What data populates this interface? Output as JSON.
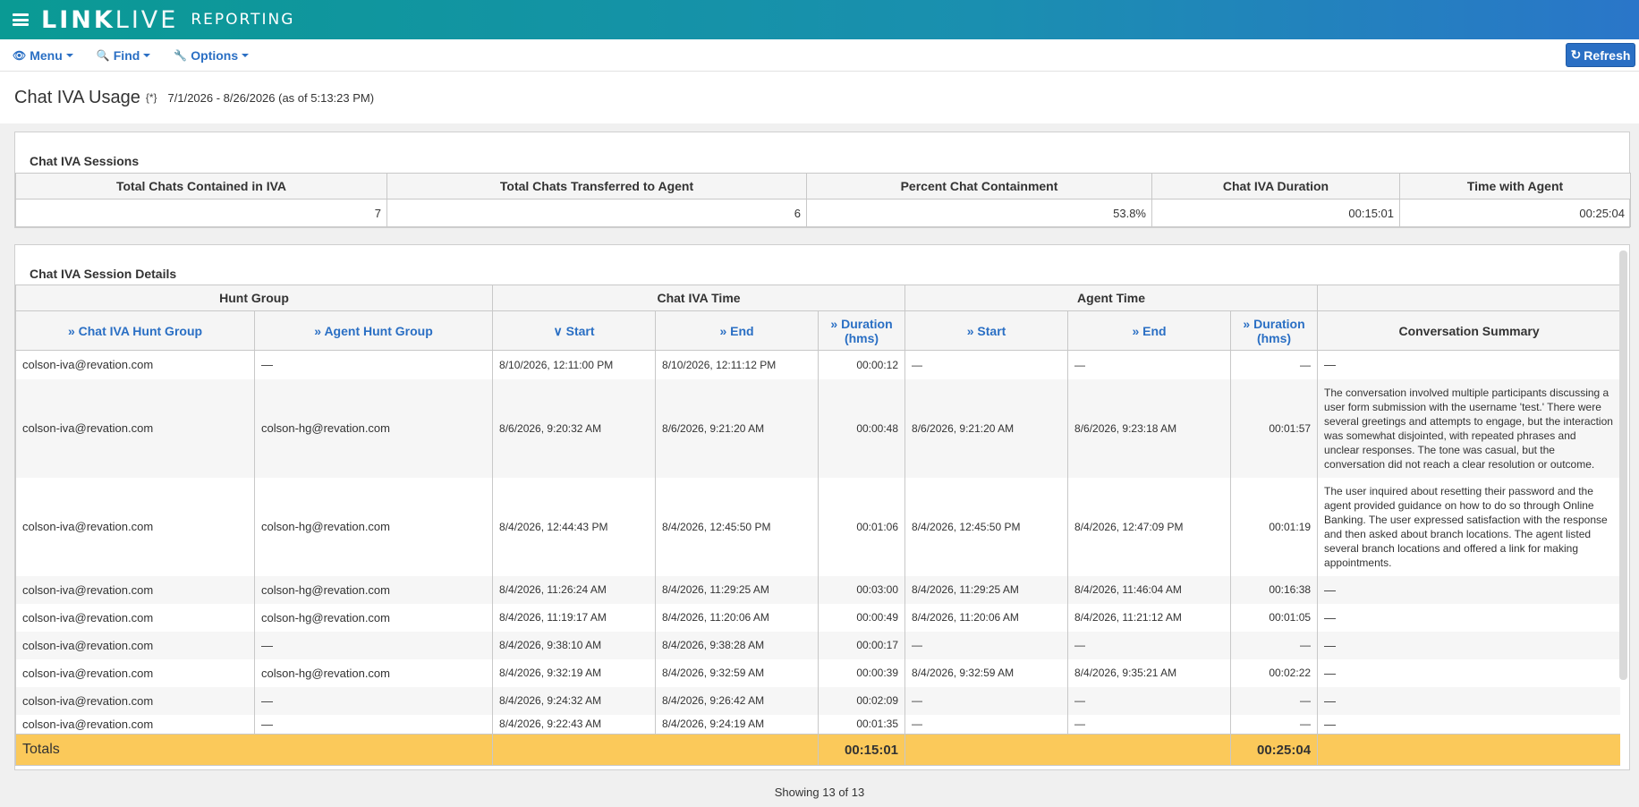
{
  "brand": {
    "bold": "LINK",
    "light": "LIVE",
    "sub": "REPORTING"
  },
  "toolbar": {
    "menu": "Menu",
    "find": "Find",
    "options": "Options",
    "refresh": "Refresh"
  },
  "page": {
    "title": "Chat IVA Usage",
    "flag": "{*}",
    "date_range": "7/1/2026 - 8/26/2026 (as of 5:13:23 PM)"
  },
  "sessions": {
    "title": "Chat IVA Sessions",
    "headers": [
      "Total Chats Contained in IVA",
      "Total Chats Transferred to Agent",
      "Percent Chat Containment",
      "Chat IVA Duration",
      "Time with Agent"
    ],
    "values": [
      "7",
      "6",
      "53.8%",
      "00:15:01",
      "00:25:04"
    ]
  },
  "details": {
    "title": "Chat IVA Session Details",
    "groups": [
      "Hunt Group",
      "Chat IVA Time",
      "Agent Time",
      ""
    ],
    "columns": [
      "Chat IVA Hunt Group",
      "Agent Hunt Group",
      "Start",
      "End",
      "Duration (hms)",
      "Start",
      "End",
      "Duration (hms)",
      "Conversation Summary"
    ],
    "rows": [
      {
        "iva_hg": "colson-iva@revation.com",
        "agent_hg": "—",
        "iva_start": "8/10/2026, 12:11:00 PM",
        "iva_end": "8/10/2026, 12:11:12 PM",
        "iva_dur": "00:00:12",
        "ag_start": "—",
        "ag_end": "—",
        "ag_dur": "—",
        "summary": "—"
      },
      {
        "iva_hg": "colson-iva@revation.com",
        "agent_hg": "colson-hg@revation.com",
        "iva_start": "8/6/2026, 9:20:32 AM",
        "iva_end": "8/6/2026, 9:21:20 AM",
        "iva_dur": "00:00:48",
        "ag_start": "8/6/2026, 9:21:20 AM",
        "ag_end": "8/6/2026, 9:23:18 AM",
        "ag_dur": "00:01:57",
        "summary": "The conversation involved multiple participants discussing a user form submission with the username 'test.' There were several greetings and attempts to engage, but the interaction was somewhat disjointed, with repeated phrases and unclear responses. The tone was casual, but the conversation did not reach a clear resolution or outcome."
      },
      {
        "iva_hg": "colson-iva@revation.com",
        "agent_hg": "colson-hg@revation.com",
        "iva_start": "8/4/2026, 12:44:43 PM",
        "iva_end": "8/4/2026, 12:45:50 PM",
        "iva_dur": "00:01:06",
        "ag_start": "8/4/2026, 12:45:50 PM",
        "ag_end": "8/4/2026, 12:47:09 PM",
        "ag_dur": "00:01:19",
        "summary": "The user inquired about resetting their password and the agent provided guidance on how to do so through Online Banking. The user expressed satisfaction with the response and then asked about branch locations. The agent listed several branch locations and offered a link for making appointments."
      },
      {
        "iva_hg": "colson-iva@revation.com",
        "agent_hg": "colson-hg@revation.com",
        "iva_start": "8/4/2026, 11:26:24 AM",
        "iva_end": "8/4/2026, 11:29:25 AM",
        "iva_dur": "00:03:00",
        "ag_start": "8/4/2026, 11:29:25 AM",
        "ag_end": "8/4/2026, 11:46:04 AM",
        "ag_dur": "00:16:38",
        "summary": "—"
      },
      {
        "iva_hg": "colson-iva@revation.com",
        "agent_hg": "colson-hg@revation.com",
        "iva_start": "8/4/2026, 11:19:17 AM",
        "iva_end": "8/4/2026, 11:20:06 AM",
        "iva_dur": "00:00:49",
        "ag_start": "8/4/2026, 11:20:06 AM",
        "ag_end": "8/4/2026, 11:21:12 AM",
        "ag_dur": "00:01:05",
        "summary": "—"
      },
      {
        "iva_hg": "colson-iva@revation.com",
        "agent_hg": "—",
        "iva_start": "8/4/2026, 9:38:10 AM",
        "iva_end": "8/4/2026, 9:38:28 AM",
        "iva_dur": "00:00:17",
        "ag_start": "—",
        "ag_end": "—",
        "ag_dur": "—",
        "summary": "—"
      },
      {
        "iva_hg": "colson-iva@revation.com",
        "agent_hg": "colson-hg@revation.com",
        "iva_start": "8/4/2026, 9:32:19 AM",
        "iva_end": "8/4/2026, 9:32:59 AM",
        "iva_dur": "00:00:39",
        "ag_start": "8/4/2026, 9:32:59 AM",
        "ag_end": "8/4/2026, 9:35:21 AM",
        "ag_dur": "00:02:22",
        "summary": "—"
      },
      {
        "iva_hg": "colson-iva@revation.com",
        "agent_hg": "—",
        "iva_start": "8/4/2026, 9:24:32 AM",
        "iva_end": "8/4/2026, 9:26:42 AM",
        "iva_dur": "00:02:09",
        "ag_start": "—",
        "ag_end": "—",
        "ag_dur": "—",
        "summary": "—"
      },
      {
        "iva_hg": "colson-iva@revation.com",
        "agent_hg": "—",
        "iva_start": "8/4/2026, 9:22:43 AM",
        "iva_end": "8/4/2026, 9:24:19 AM",
        "iva_dur": "00:01:35",
        "ag_start": "—",
        "ag_end": "—",
        "ag_dur": "—",
        "summary": "—"
      }
    ],
    "totals": {
      "label": "Totals",
      "iva_dur": "00:15:01",
      "ag_dur": "00:25:04"
    },
    "footer": "Showing 13 of 13"
  }
}
